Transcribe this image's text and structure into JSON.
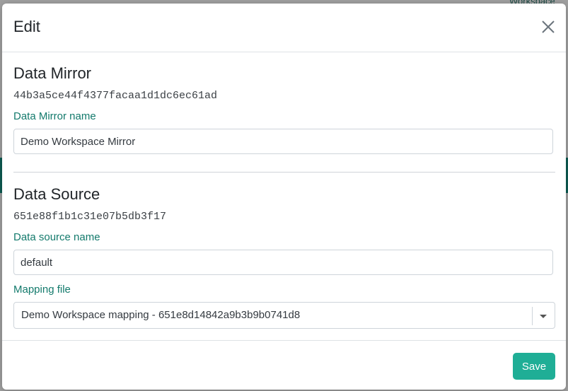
{
  "background": {
    "tab_text": "Workspace"
  },
  "modal": {
    "title": "Edit",
    "close_icon": "close-icon"
  },
  "data_mirror": {
    "heading": "Data Mirror",
    "id": "44b3a5ce44f4377facaa1d1dc6ec61ad",
    "name_label": "Data Mirror name",
    "name_value": "Demo Workspace Mirror"
  },
  "data_source": {
    "heading": "Data Source",
    "id": "651e88f1b1c31e07b5db3f17",
    "name_label": "Data source name",
    "name_value": "default",
    "mapping_label": "Mapping file",
    "mapping_value": "Demo Workspace mapping - 651e8d14842a9b3b9b0741d8",
    "dropdown_icon": "chevron-down-icon"
  },
  "footer": {
    "save_label": "Save"
  },
  "colors": {
    "accent": "#1fae96",
    "label": "#137a6c",
    "overlay": "#9c9c9c"
  }
}
